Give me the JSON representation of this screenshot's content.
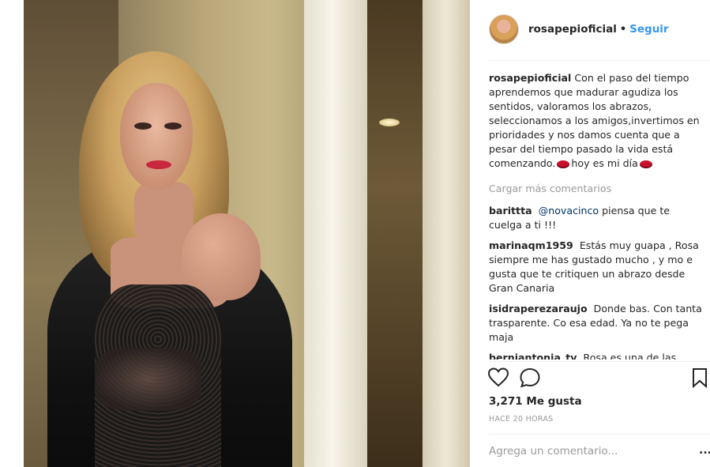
{
  "post": {
    "username": "rosapepioficial",
    "follow_label": "Seguir",
    "separator": "•"
  },
  "comments": {
    "caption_user": "rosapepioficial",
    "caption_text_1": "Con el paso del tiempo aprendemos que madurar agudiza los sentidos, valoramos los abrazos, seleccionamos a los amigos,invertimos en prioridades y nos damos cuenta que a pesar del tiempo pasado la vida está comenzando.",
    "caption_text_2": "hoy es mi día",
    "load_more": "Cargar más comentarios",
    "items": [
      {
        "user": "barittta",
        "mention": "@novacinco",
        "text": "piensa que te cuelga a ti !!!"
      },
      {
        "user": "marinaqm1959",
        "text": "Estás muy guapa , Rosa siempre me has gustado mucho , y mo e gusta que te critiquen un abrazo desde Gran Canaria"
      },
      {
        "user": "isidraperezaraujo",
        "text": "Donde bas. Con tanta trasparente. Co esa edad. Ya no te pega maja"
      },
      {
        "user": "berniantonia_tv",
        "text": "Rosa es una de las mujeres que los años la hacen más atractiva, no"
      }
    ]
  },
  "actions": {
    "like_icon": "heart-icon",
    "comment_icon": "speech-bubble-icon",
    "save_icon": "bookmark-icon"
  },
  "likes_text": "3,271 Me gusta",
  "timestamp": "HACE 20 HORAS",
  "add_comment_placeholder": "Agrega un comentario...",
  "more_options": "...",
  "colors": {
    "link_blue": "#3897f0",
    "muted_gray": "#999999",
    "text_dark": "#262626"
  }
}
